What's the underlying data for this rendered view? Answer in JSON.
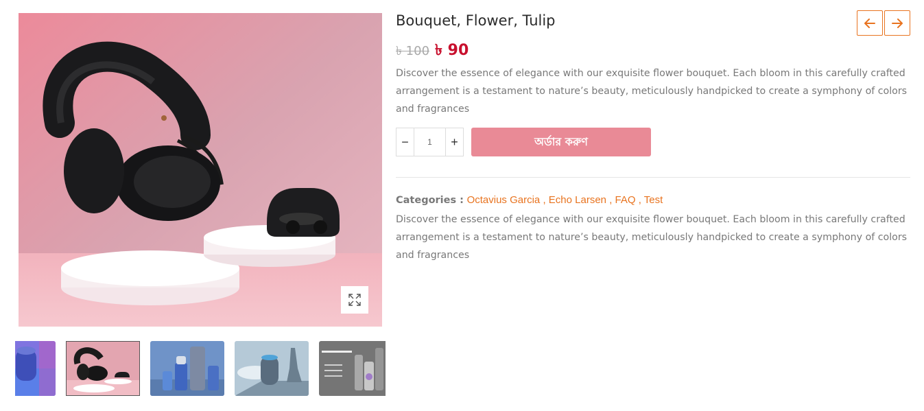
{
  "product": {
    "title": "Bouquet, Flower, Tulip",
    "price_old": "৳ 100",
    "price_new": "৳ 90",
    "description": "Discover the essence of elegance with our exquisite flower bouquet. Each bloom in this carefully crafted arrangement is a testament to nature’s beauty, meticulously handpicked to create a symphony of colors and fragrances",
    "quantity": "1",
    "order_label": "অর্ডার করুণ",
    "categories_label": "Categories :",
    "categories": [
      "Octavius Garcia",
      "Echo Larsen",
      "FAQ",
      "Test"
    ],
    "long_description": "Discover the essence of elegance with our exquisite flower bouquet. Each bloom in this carefully crafted arrangement is a testament to nature’s beauty, meticulously handpicked to create a symphony of colors and fragrances"
  },
  "gallery": {
    "main_image": "headphones-earbuds-on-pink-podium",
    "thumbnails": [
      "blue-speaker",
      "headphones-earbuds",
      "cosmetic-bottles",
      "smart-speaker",
      "electronic-cigarette"
    ],
    "active_index": 1
  },
  "controls": {
    "minus": "−",
    "plus": "+"
  },
  "icons": {
    "prev": "arrow-left-icon",
    "next": "arrow-right-icon",
    "zoom": "expand-icon"
  },
  "colors": {
    "accent": "#e8731f",
    "sale_price": "#c8102e",
    "order_button": "#e98a96"
  }
}
